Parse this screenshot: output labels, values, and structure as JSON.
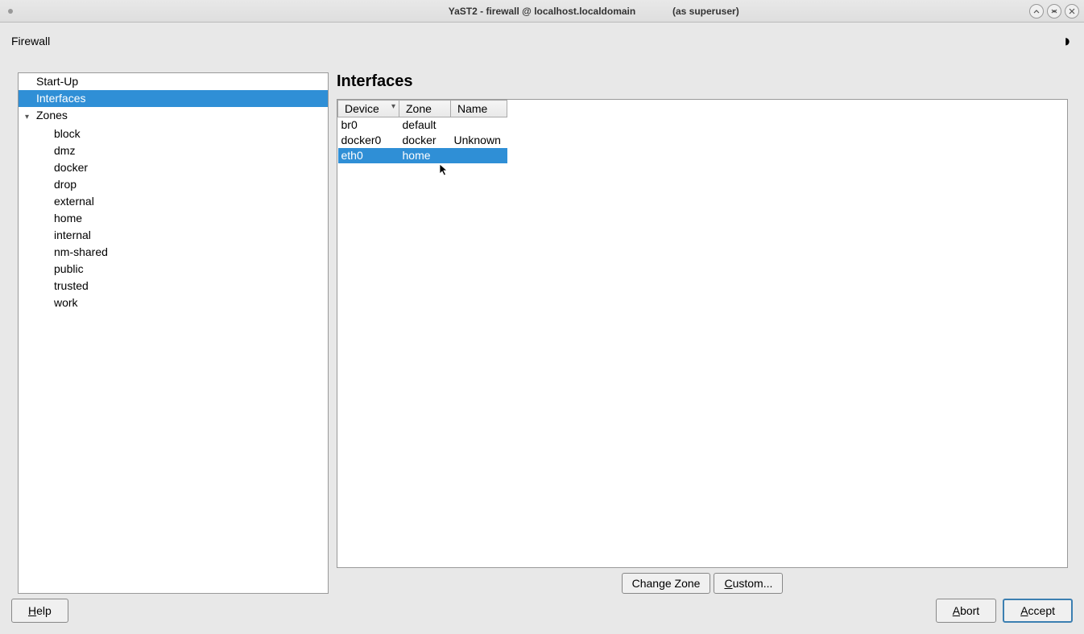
{
  "window": {
    "title": "YaST2 - firewall @ localhost.localdomain",
    "extra": "(as superuser)"
  },
  "menubar": {
    "title": "Firewall"
  },
  "sidebar": {
    "items": [
      {
        "label": "Start-Up",
        "selected": false
      },
      {
        "label": "Interfaces",
        "selected": true
      },
      {
        "label": "Zones",
        "expandable": true,
        "children": [
          "block",
          "dmz",
          "docker",
          "drop",
          "external",
          "home",
          "internal",
          "nm-shared",
          "public",
          "trusted",
          "work"
        ]
      }
    ]
  },
  "main": {
    "heading": "Interfaces",
    "columns": {
      "device": "Device",
      "zone": "Zone",
      "name": "Name"
    },
    "rows": [
      {
        "device": "br0",
        "zone": "default",
        "name": ""
      },
      {
        "device": "docker0",
        "zone": "docker",
        "name": "Unknown"
      },
      {
        "device": "eth0",
        "zone": "home",
        "name": "",
        "selected": true
      }
    ],
    "buttons": {
      "change_zone": "Change Zone",
      "custom_prefix": "C",
      "custom_rest": "ustom..."
    }
  },
  "footer": {
    "help_prefix": "H",
    "help_rest": "elp",
    "abort_prefix": "A",
    "abort_rest": "bort",
    "accept_prefix": "A",
    "accept_rest": "ccept"
  }
}
